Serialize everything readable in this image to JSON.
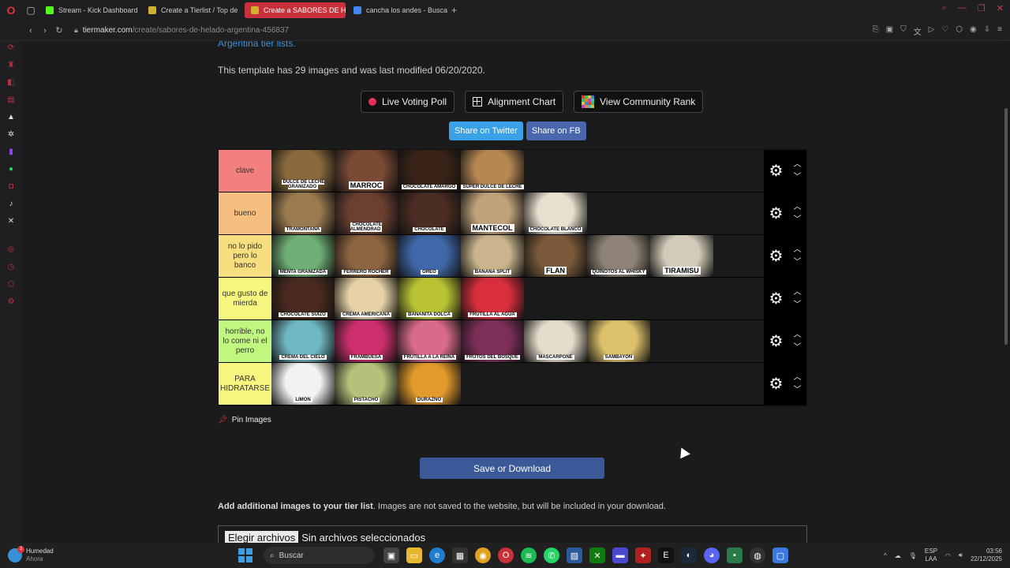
{
  "browser": {
    "tabs": [
      {
        "label": "Stream - Kick Dashboard",
        "color": "#53fc18"
      },
      {
        "label": "Create a Tierlist / Top de",
        "color": "#d1b02e"
      },
      {
        "label": "Create a SABORES DE HE",
        "color": "#d1b02e",
        "active": true
      },
      {
        "label": "cancha los andes - Busca",
        "color": "#4285f4"
      }
    ],
    "url_domain": "tiermaker.com",
    "url_path": "/create/sabores-de-helado-argentina-456837"
  },
  "page": {
    "top_link": "Argentina tier lists",
    "info_text": "This template has 29 images and was last modified 06/20/2020.",
    "buttons": {
      "live_voting": "Live Voting Poll",
      "alignment": "Alignment Chart",
      "community": "View Community Rank"
    },
    "share": {
      "twitter": "Share on Twitter",
      "fb": "Share on FB"
    },
    "pin_images": "Pin Images",
    "save_button": "Save or Download",
    "add_images_bold": "Add additional images to your tier list",
    "add_images_rest": ". Images are not saved to the website, but will be included in your download.",
    "file_button": "Elegir archivos",
    "file_status": "Sin archivos seleccionados"
  },
  "tiers": [
    {
      "label": "clave",
      "color": "#f47f7f",
      "items": [
        {
          "caption": "DULCE DE LECHE GRANIZADO",
          "bg": "#8a6a3c"
        },
        {
          "caption": "MARROC",
          "bg": "#7a4a35",
          "big": true
        },
        {
          "caption": "CHOCOLATE AMARGO",
          "bg": "#3a2418"
        },
        {
          "caption": "SUPER DULCE DE LECHE",
          "bg": "#b58752"
        }
      ]
    },
    {
      "label": "bueno",
      "color": "#f7bf7f",
      "items": [
        {
          "caption": "TRAMONTANA",
          "bg": "#9a7a4f"
        },
        {
          "caption": "CHOCOLATE ALMENDRAD",
          "bg": "#6b4030"
        },
        {
          "caption": "CHOCOLATE",
          "bg": "#4a2c22"
        },
        {
          "caption": "MANTECOL",
          "bg": "#c0a27a",
          "big": true
        },
        {
          "caption": "CHOCOLATE BLANCO",
          "bg": "#e8e0cf"
        }
      ]
    },
    {
      "label": "no lo pido pero lo banco",
      "color": "#f7df7f",
      "items": [
        {
          "caption": "MENTA GRANIZADA",
          "bg": "#6fae74"
        },
        {
          "caption": "FERRERO ROCHER",
          "bg": "#8c6440"
        },
        {
          "caption": "OREO",
          "bg": "#3f68a8"
        },
        {
          "caption": "BANANA SPLIT",
          "bg": "#c9b48d"
        },
        {
          "caption": "FLAN",
          "bg": "#7a5a3a",
          "big": true
        },
        {
          "caption": "QUINOTOS AL WHISKY",
          "bg": "#8d8275"
        },
        {
          "caption": "TIRAMISU",
          "bg": "#d2cbb9",
          "big": true
        }
      ]
    },
    {
      "label": "que gusto de mierda",
      "color": "#f7f77f",
      "items": [
        {
          "caption": "CHOCOLATE SUIZO",
          "bg": "#4a2a20"
        },
        {
          "caption": "CREMA AMERICANA",
          "bg": "#e6d2a6"
        },
        {
          "caption": "BANANITA DOLCA",
          "bg": "#b9c234"
        },
        {
          "caption": "FRUTILLA AL AGUA",
          "bg": "#d92f3c"
        }
      ]
    },
    {
      "label": "horrible, no lo come ni el perro",
      "color": "#bff77f",
      "items": [
        {
          "caption": "CREMA DEL CIELO",
          "bg": "#6fb7c2"
        },
        {
          "caption": "FRAMBUESA",
          "bg": "#cc2f6c"
        },
        {
          "caption": "FRUTILLA A LA REINA",
          "bg": "#d86a8a"
        },
        {
          "caption": "FRUTOS DEL BOSQUE",
          "bg": "#7e2f59"
        },
        {
          "caption": "MASCARPONE",
          "bg": "#e6dccb"
        },
        {
          "caption": "SAMBAYON",
          "bg": "#dcc06a"
        }
      ]
    },
    {
      "label": "PARA HIDRATARSE",
      "color": "#f7f77f",
      "items": [
        {
          "caption": "LIMON",
          "bg": "#f0f3f0"
        },
        {
          "caption": "PISTACHO",
          "bg": "#b6c07a"
        },
        {
          "caption": "DURAZNO",
          "bg": "#e29a2c"
        }
      ]
    }
  ],
  "taskbar": {
    "weather_title": "Humedad",
    "weather_sub": "Ahora",
    "weather_badge": "3",
    "search": "Buscar",
    "lang_1": "ESP",
    "lang_2": "LAA",
    "time": "03:56",
    "date": "22/12/2025"
  }
}
